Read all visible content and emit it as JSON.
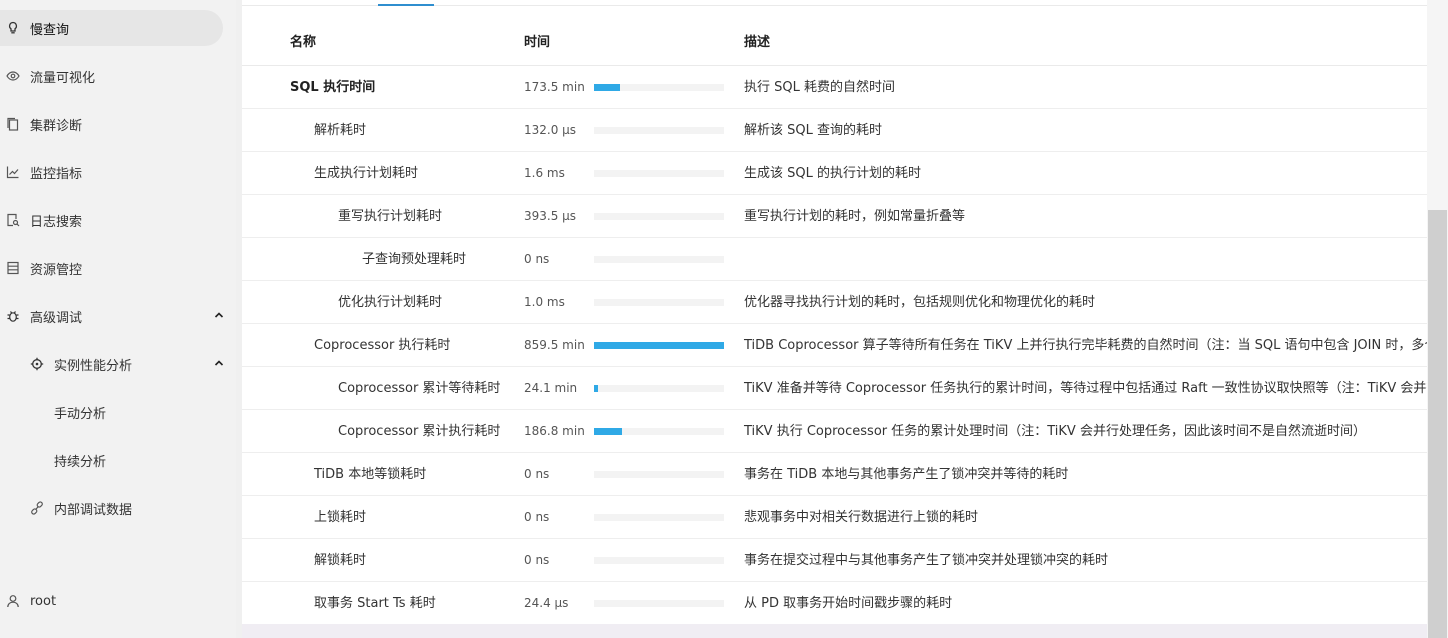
{
  "sidebar": {
    "items": [
      {
        "label": "慢查询",
        "icon": "bulb-icon"
      },
      {
        "label": "流量可视化",
        "icon": "eye-icon"
      },
      {
        "label": "集群诊断",
        "icon": "copy-icon"
      },
      {
        "label": "监控指标",
        "icon": "line-chart-icon"
      },
      {
        "label": "日志搜索",
        "icon": "file-search-icon"
      },
      {
        "label": "资源管控",
        "icon": "database-icon"
      },
      {
        "label": "高级调试",
        "icon": "bug-icon"
      },
      {
        "label": "实例性能分析",
        "icon": "aim-icon"
      },
      {
        "label": "手动分析"
      },
      {
        "label": "持续分析"
      },
      {
        "label": "内部调试数据",
        "icon": "link-icon"
      }
    ],
    "user": "root"
  },
  "table": {
    "headers": {
      "name": "名称",
      "time": "时间",
      "desc": "描述"
    },
    "rows": [
      {
        "name": "SQL 执行时间",
        "time": "173.5 min",
        "fraction": 0.202,
        "desc": "执行 SQL 耗费的自然时间"
      },
      {
        "name": "解析耗时",
        "time": "132.0 μs",
        "fraction": 0,
        "desc": "解析该 SQL 查询的耗时"
      },
      {
        "name": "生成执行计划耗时",
        "time": "1.6 ms",
        "fraction": 0,
        "desc": "生成该 SQL 的执行计划的耗时"
      },
      {
        "name": "重写执行计划耗时",
        "time": "393.5 μs",
        "fraction": 0,
        "desc": "重写执行计划的耗时，例如常量折叠等"
      },
      {
        "name": "子查询预处理耗时",
        "time": "0 ns",
        "fraction": 0,
        "desc": ""
      },
      {
        "name": "优化执行计划耗时",
        "time": "1.0 ms",
        "fraction": 0,
        "desc": "优化器寻找执行计划的耗时，包括规则优化和物理优化的耗时"
      },
      {
        "name": "Coprocessor 执行耗时",
        "time": "859.5 min",
        "fraction": 1.0,
        "desc": "TiDB Coprocessor 算子等待所有任务在 TiKV 上并行执行完毕耗费的自然时间（注：当 SQL 语句中包含 JOIN 时，多个"
      },
      {
        "name": "Coprocessor 累计等待耗时",
        "time": "24.1 min",
        "fraction": 0.028,
        "desc": "TiKV 准备并等待 Coprocessor 任务执行的累计时间，等待过程中包括通过 Raft 一致性协议取快照等（注：TiKV 会并行"
      },
      {
        "name": "Coprocessor 累计执行耗时",
        "time": "186.8 min",
        "fraction": 0.217,
        "desc": "TiKV 执行 Coprocessor 任务的累计处理时间（注：TiKV 会并行处理任务，因此该时间不是自然流逝时间）"
      },
      {
        "name": "TiDB 本地等锁耗时",
        "time": "0 ns",
        "fraction": 0,
        "desc": "事务在 TiDB 本地与其他事务产生了锁冲突并等待的耗时"
      },
      {
        "name": "上锁耗时",
        "time": "0 ns",
        "fraction": 0,
        "desc": "悲观事务中对相关行数据进行上锁的耗时"
      },
      {
        "name": "解锁耗时",
        "time": "0 ns",
        "fraction": 0,
        "desc": "事务在提交过程中与其他事务产生了锁冲突并处理锁冲突的耗时"
      },
      {
        "name": "取事务 Start Ts 耗时",
        "time": "24.4 μs",
        "fraction": 0,
        "desc": "从 PD 取事务开始时间戳步骤的耗时"
      }
    ]
  },
  "colors": {
    "accent": "#2fa9e6",
    "tab_ink": "#2f8ecf"
  }
}
